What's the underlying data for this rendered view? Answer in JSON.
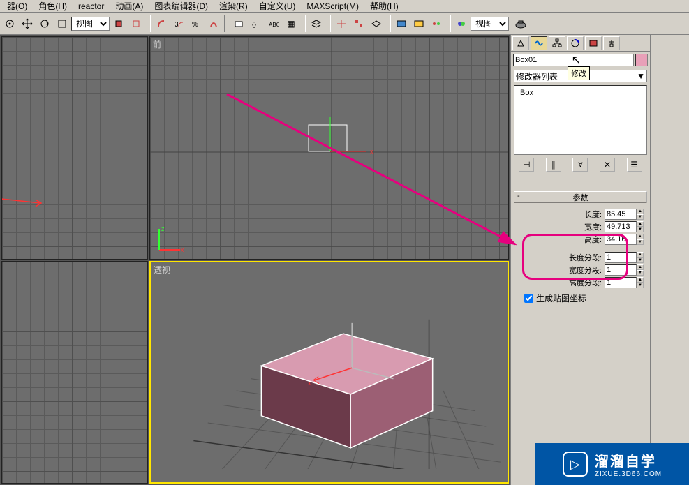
{
  "menu": {
    "items": [
      "器(O)",
      "角色(H)",
      "reactor",
      "动画(A)",
      "图表编辑器(D)",
      "渲染(R)",
      "自定义(U)",
      "MAXScript(M)",
      "帮助(H)"
    ]
  },
  "toolbar": {
    "view_select": "视图",
    "view_select2": "视图"
  },
  "viewports": {
    "front_label": "前",
    "persp_label": "透视"
  },
  "panel": {
    "object_name": "Box01",
    "tooltip": "修改",
    "modifier_list_label": "修改器列表",
    "stack_item": "Box",
    "rollout_title": "参数",
    "params": {
      "length_label": "长度:",
      "length_value": "85.45",
      "width_label": "宽度:",
      "width_value": "49.713",
      "height_label": "高度:",
      "height_value": "34.16",
      "lseg_label": "长度分段:",
      "lseg_value": "1",
      "wseg_label": "宽度分段:",
      "wseg_value": "1",
      "hseg_label": "高度分段:",
      "hseg_value": "1",
      "gen_uv_label": "生成贴图坐标"
    }
  },
  "watermark": {
    "title": "溜溜自学",
    "sub": "ZIXUE.3D66.COM"
  }
}
